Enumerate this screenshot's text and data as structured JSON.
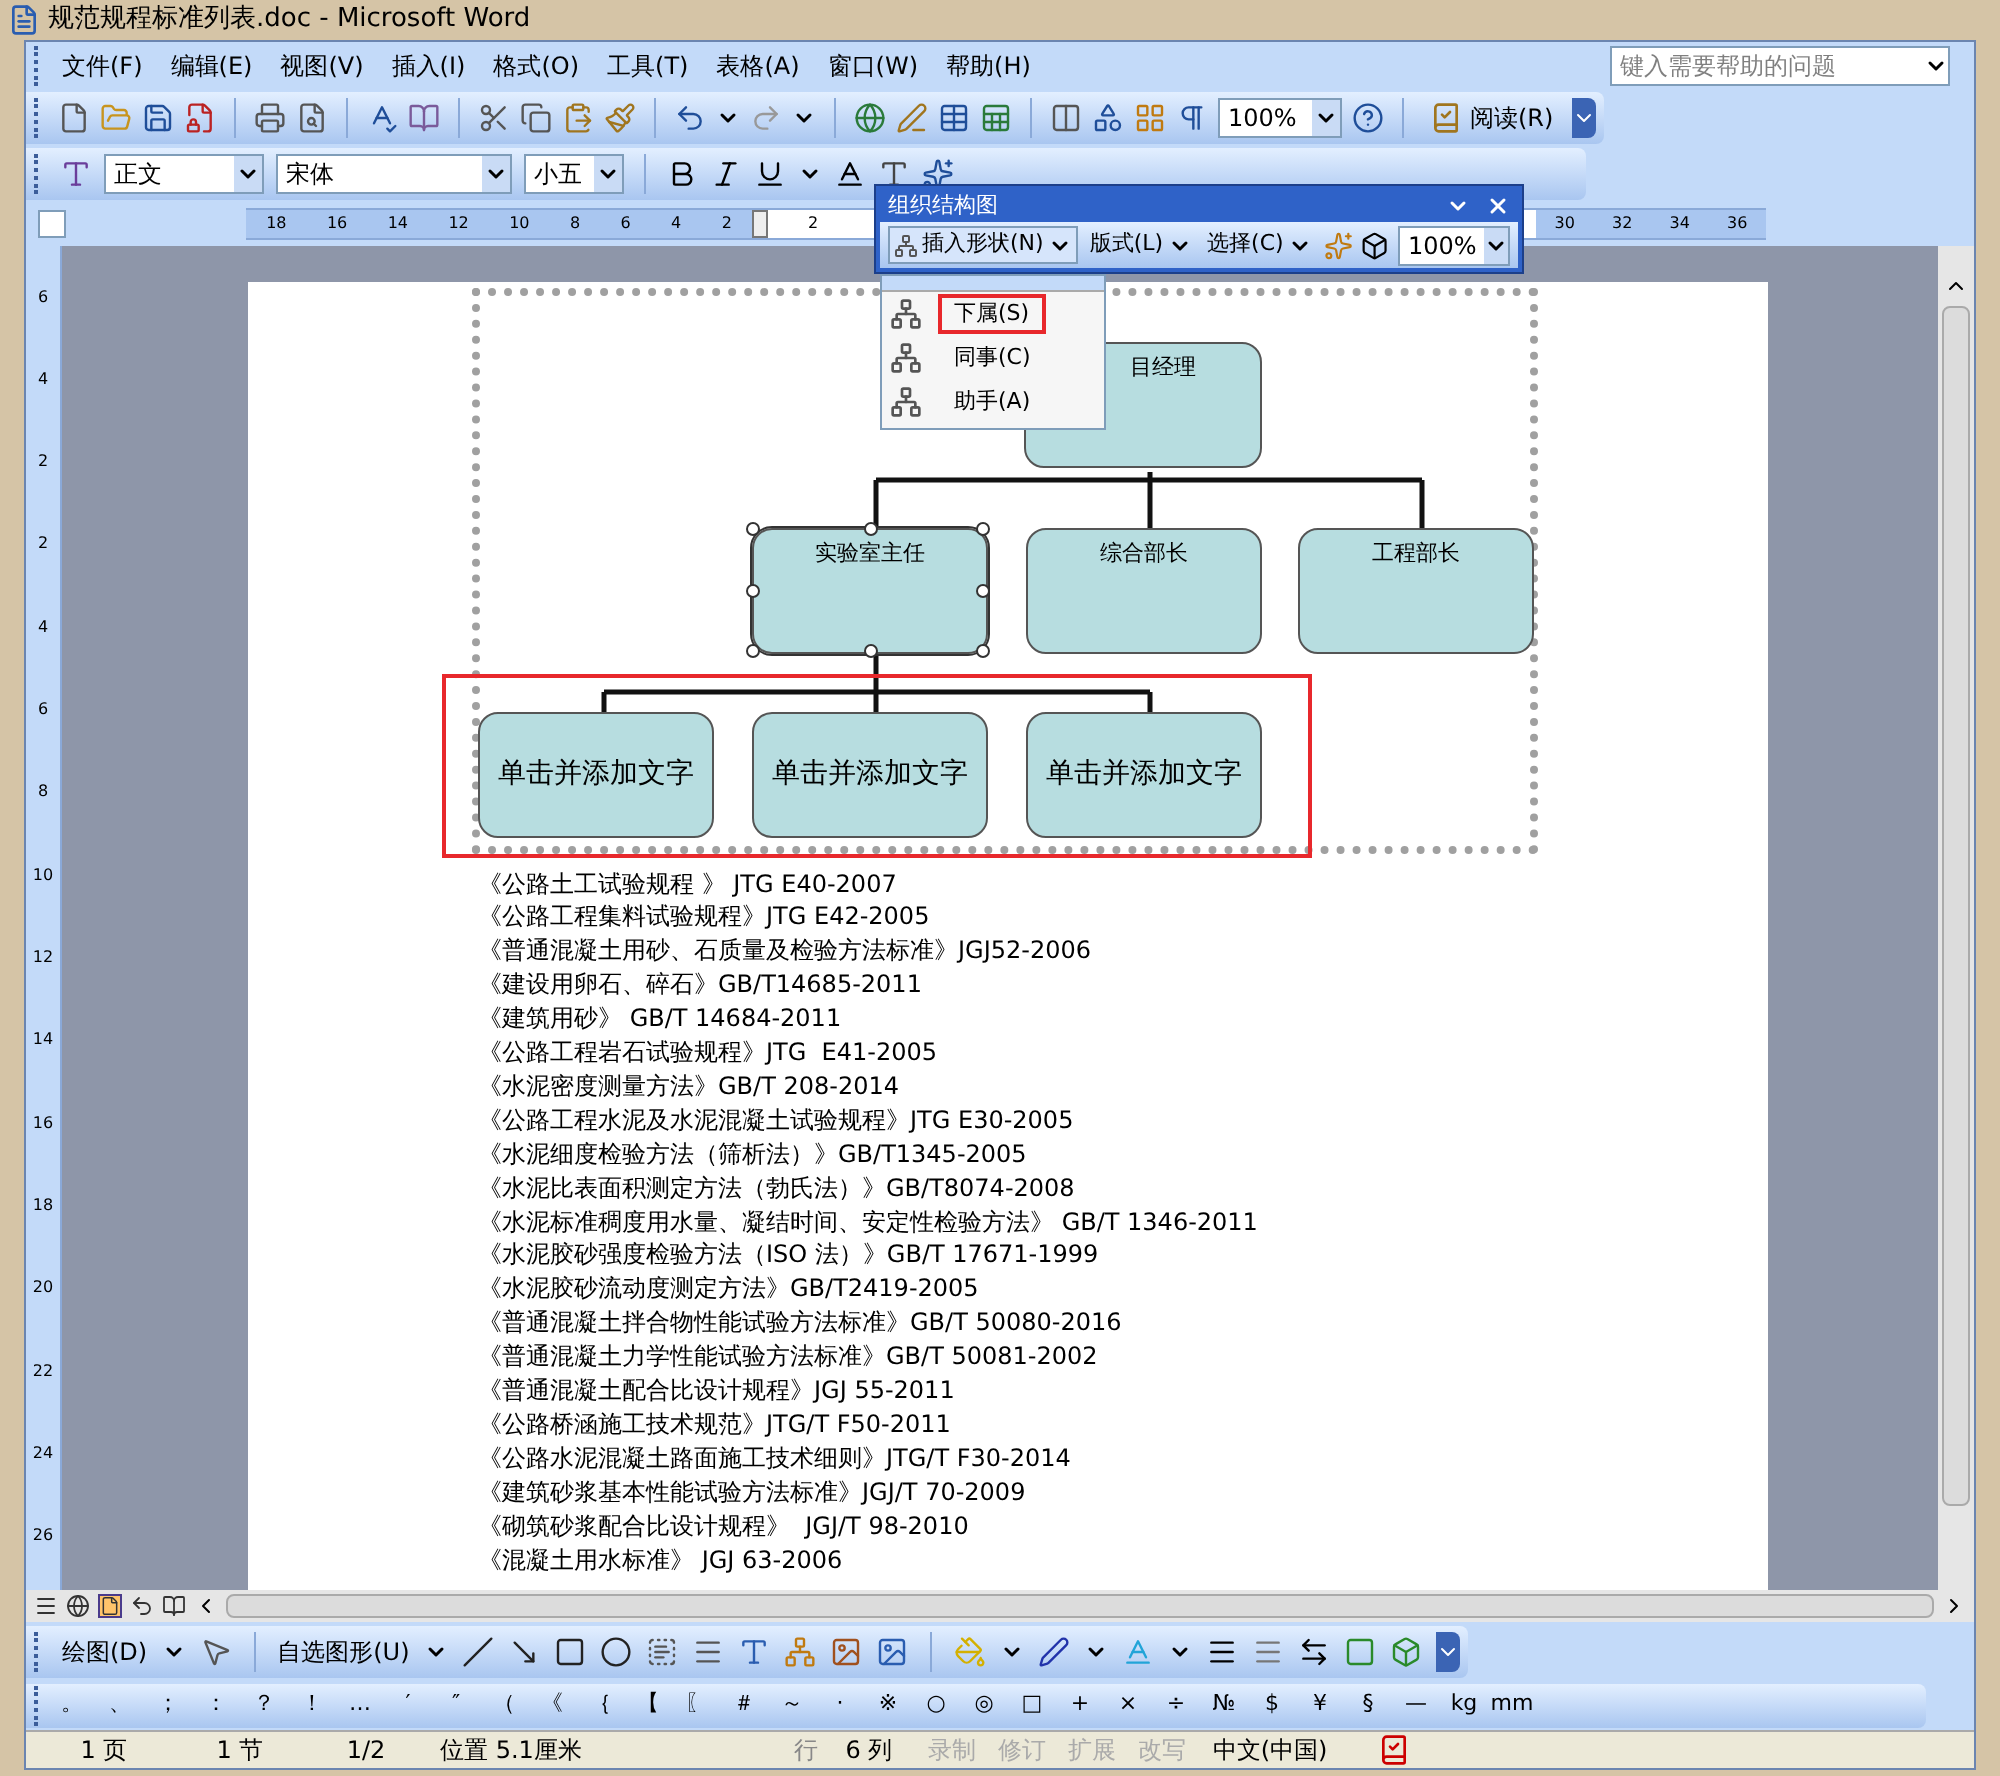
{
  "window": {
    "title": "规范规程标准列表.doc - Microsoft Word"
  },
  "menu_bar": [
    {
      "label": "文件(F)"
    },
    {
      "label": "编辑(E)"
    },
    {
      "label": "视图(V)"
    },
    {
      "label": "插入(I)"
    },
    {
      "label": "格式(O)"
    },
    {
      "label": "工具(T)"
    },
    {
      "label": "表格(A)"
    },
    {
      "label": "窗口(W)"
    },
    {
      "label": "帮助(H)"
    }
  ],
  "help_box": {
    "placeholder": "键入需要帮助的问题"
  },
  "standard_toolbar": {
    "zoom": "100%",
    "read_button": "阅读(R)"
  },
  "formatting_toolbar": {
    "style": "正文",
    "font": "宋体",
    "size": "小五"
  },
  "ruler": {
    "left_labels": [
      "18",
      "16",
      "14",
      "12",
      "10",
      "8",
      "6",
      "4",
      "2"
    ],
    "mid_labels": [
      "2"
    ],
    "right_labels": [
      "30",
      "32",
      "34",
      "36"
    ]
  },
  "vertical_ruler": {
    "labels": [
      "6",
      "4",
      "2",
      "2",
      "4",
      "6",
      "8",
      "10",
      "12",
      "14",
      "16",
      "18",
      "20",
      "22",
      "24",
      "26"
    ]
  },
  "org_chart_toolbar": {
    "title": "组织结构图",
    "buttons": [
      {
        "label": "插入形状(N)"
      },
      {
        "label": "版式(L)"
      },
      {
        "label": "选择(C)"
      }
    ],
    "zoom": "100%"
  },
  "insert_shape_menu": [
    {
      "label": "下属(S)",
      "selected": true
    },
    {
      "label": "同事(C)",
      "selected": false
    },
    {
      "label": "助手(A)",
      "selected": false
    }
  ],
  "org_chart": {
    "root": "目经理",
    "managers": [
      {
        "label": "实验室主任",
        "selected": true
      },
      {
        "label": "综合部长",
        "selected": false
      },
      {
        "label": "工程部长",
        "selected": false
      }
    ],
    "subordinates": [
      "单击并添加文字",
      "单击并添加文字",
      "单击并添加文字"
    ],
    "subordinates_highlighted": true
  },
  "document_lines": [
    "《公路土工试验规程 》 JTG E40-2007",
    "《公路工程集料试验规程》JTG E42-2005",
    "《普通混凝土用砂、石质量及检验方法标准》JGJ52-2006",
    "《建设用卵石、碎石》GB/T14685-2011",
    "《建筑用砂》 GB/T 14684-2011",
    "《公路工程岩石试验规程》JTG  E41-2005",
    "《水泥密度测量方法》GB/T 208-2014",
    "《公路工程水泥及水泥混凝土试验规程》JTG E30-2005",
    "《水泥细度检验方法（筛析法）》GB/T1345-2005",
    "《水泥比表面积测定方法（勃氏法）》GB/T8074-2008",
    "《水泥标准稠度用水量、凝结时间、安定性检验方法》 GB/T 1346-2011",
    "《水泥胶砂强度检验方法（ISO 法）》GB/T 17671-1999",
    "《水泥胶砂流动度测定方法》GB/T2419-2005",
    "《普通混凝土拌合物性能试验方法标准》GB/T 50080-2016",
    "《普通混凝土力学性能试验方法标准》GB/T 50081-2002",
    "《普通混凝土配合比设计规程》JGJ 55-2011",
    "《公路桥涵施工技术规范》JTG/T F50-2011",
    "《公路水泥混凝土路面施工技术细则》JTG/T F30-2014",
    "《建筑砂浆基本性能试验方法标准》JGJ/T 70-2009",
    "《砌筑砂浆配合比设计规程》  JGJ/T 98-2010",
    "《混凝土用水标准》 JGJ 63-2006"
  ],
  "drawing_toolbar": {
    "draw_menu": "绘图(D)",
    "autoshapes_menu": "自选图形(U)"
  },
  "symbol_toolbar": [
    "。",
    "、",
    "；",
    "：",
    "？",
    "！",
    "…",
    "′",
    "″",
    "（",
    "《",
    "｛",
    "【",
    "〖",
    "＃",
    "～",
    "·",
    "※",
    "○",
    "◎",
    "□",
    "+",
    "×",
    "÷",
    "№",
    "$",
    "¥",
    "§",
    "—",
    "kg",
    "mm"
  ],
  "status_bar": {
    "page": "1 页",
    "section": "1 节",
    "pages": "1/2",
    "position": "位置 5.1厘米",
    "line": "行",
    "column": "6 列",
    "modes": [
      {
        "label": "录制",
        "on": false
      },
      {
        "label": "修订",
        "on": false
      },
      {
        "label": "扩展",
        "on": false
      },
      {
        "label": "改写",
        "on": false
      }
    ],
    "language": "中文(中国)"
  }
}
